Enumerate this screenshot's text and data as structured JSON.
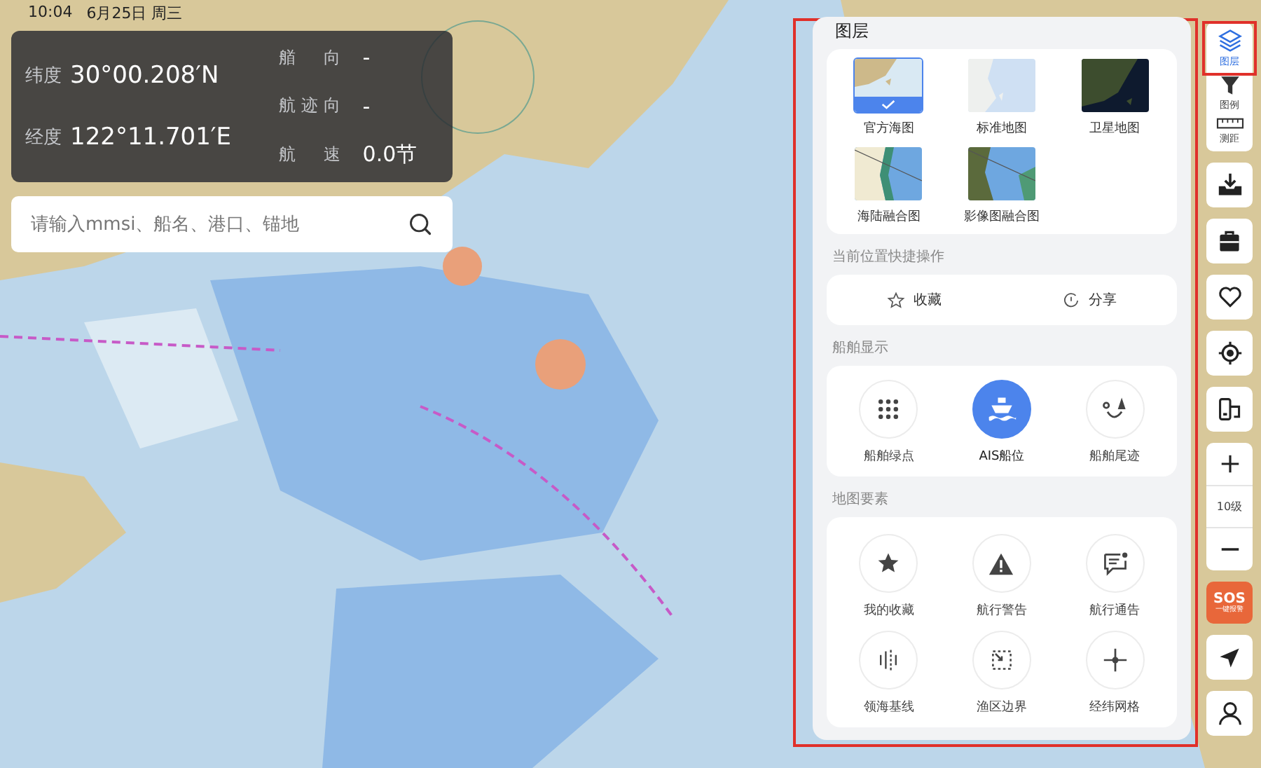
{
  "status_bar": {
    "time": "10:04",
    "date": "6月25日 周三"
  },
  "info_panel": {
    "left": [
      {
        "label": "纬度",
        "value": "30°00.208′N"
      },
      {
        "label": "经度",
        "value": "122°11.701′E"
      }
    ],
    "right": [
      {
        "label": "艏向",
        "value": "-"
      },
      {
        "label": "航迹向",
        "value": "-"
      },
      {
        "label": "航速",
        "value": "0.0节"
      }
    ]
  },
  "search": {
    "placeholder": "请输入mmsi、船名、港口、锚地"
  },
  "layers_panel": {
    "title": "图层",
    "map_types": [
      {
        "label": "官方海图",
        "kind": "chart",
        "selected": true
      },
      {
        "label": "标准地图",
        "kind": "standard",
        "selected": false
      },
      {
        "label": "卫星地图",
        "kind": "satellite",
        "selected": false
      },
      {
        "label": "海陆融合图",
        "kind": "landsea",
        "selected": false
      },
      {
        "label": "影像图融合图",
        "kind": "imagery",
        "selected": false
      }
    ],
    "quick_title": "当前位置快捷操作",
    "quick_actions": [
      {
        "label": "收藏",
        "kind": "favorite"
      },
      {
        "label": "分享",
        "kind": "share"
      }
    ],
    "ship_title": "船舶显示",
    "ship_display": [
      {
        "label": "船舶绿点",
        "kind": "dots",
        "selected": false
      },
      {
        "label": "AIS船位",
        "kind": "ship",
        "selected": true
      },
      {
        "label": "船舶尾迹",
        "kind": "trail",
        "selected": false
      }
    ],
    "elements_title": "地图要素",
    "map_elements": [
      {
        "label": "我的收藏",
        "kind": "star"
      },
      {
        "label": "航行警告",
        "kind": "warning"
      },
      {
        "label": "航行通告",
        "kind": "notice"
      },
      {
        "label": "领海基线",
        "kind": "baseline"
      },
      {
        "label": "渔区边界",
        "kind": "fishery"
      },
      {
        "label": "经纬网格",
        "kind": "grid"
      }
    ]
  },
  "toolbar": {
    "top": [
      {
        "kind": "layers",
        "label": "图层",
        "selected": true
      },
      {
        "kind": "legend",
        "label": "图例",
        "selected": false
      },
      {
        "kind": "measure",
        "label": "测距",
        "selected": false
      }
    ],
    "buttons": [
      {
        "kind": "download"
      },
      {
        "kind": "toolbox"
      },
      {
        "kind": "heart"
      },
      {
        "kind": "locate"
      },
      {
        "kind": "devices"
      }
    ],
    "zoom_level": "10级",
    "sos": {
      "title": "SOS",
      "subtitle": "一键报警"
    },
    "bottom": [
      {
        "kind": "navigate"
      },
      {
        "kind": "user"
      }
    ]
  }
}
